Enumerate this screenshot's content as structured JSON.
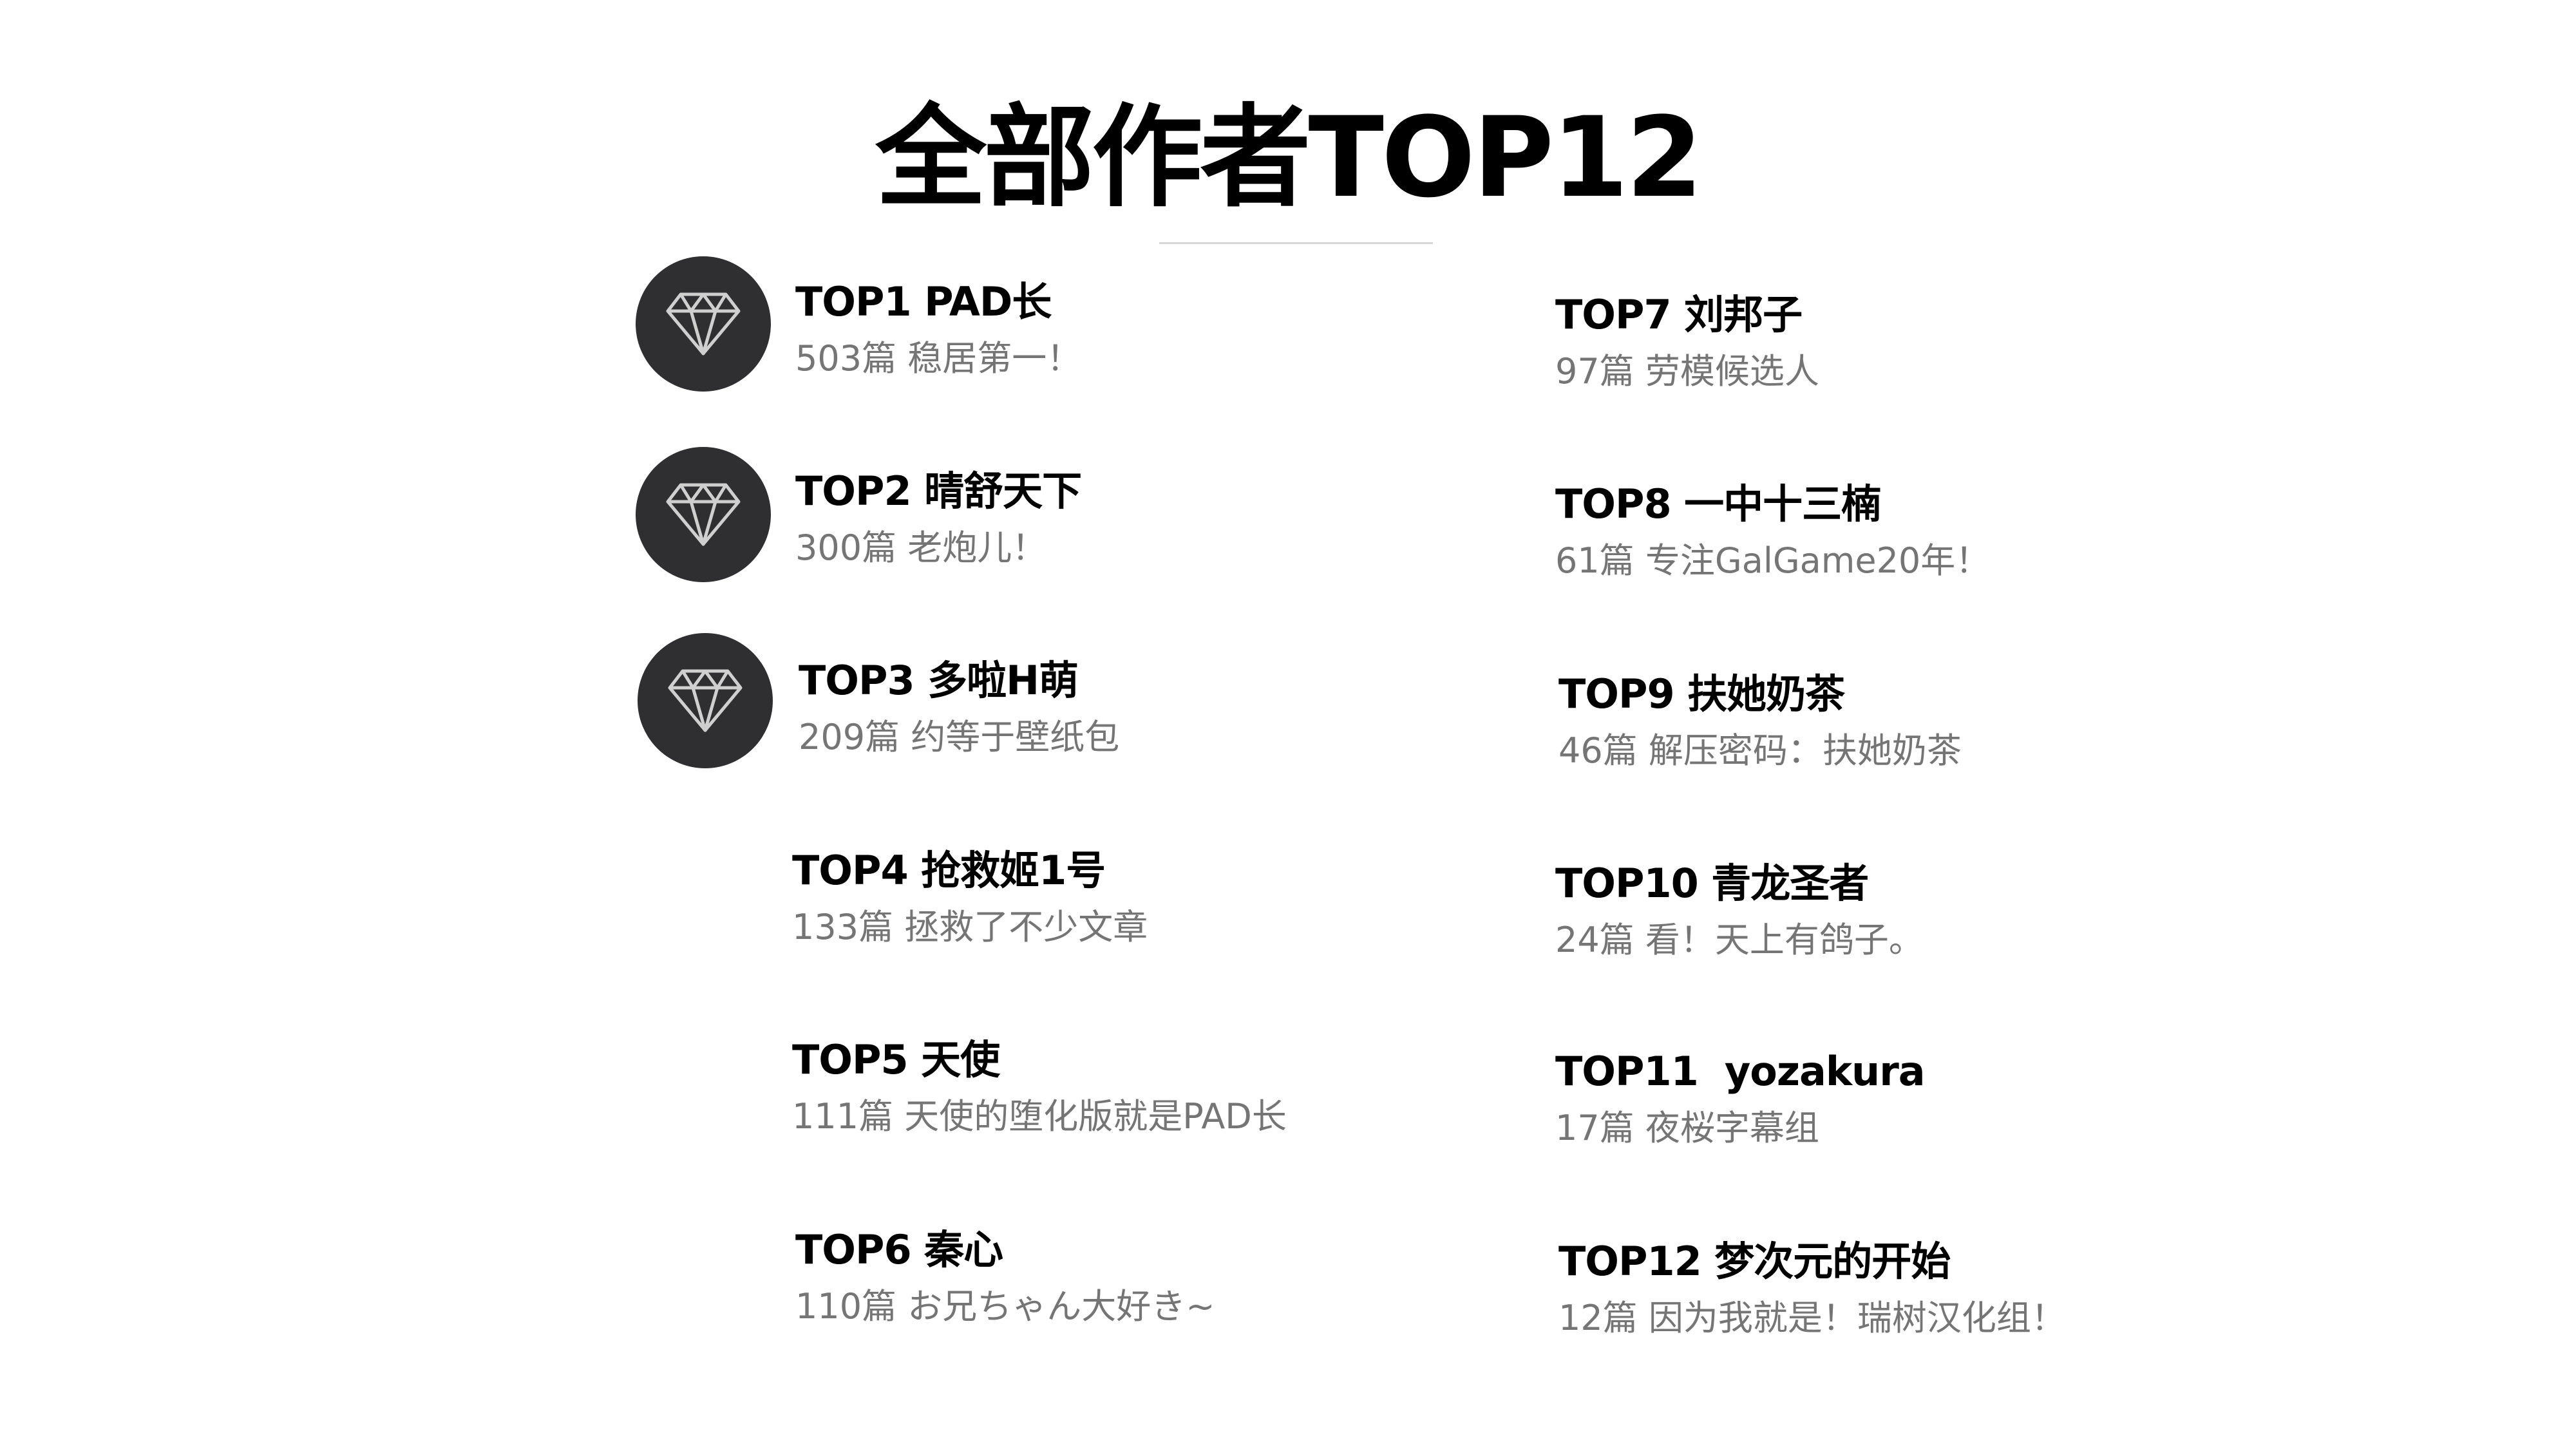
{
  "title": "全部作者TOP12",
  "icons": {
    "badge": "diamond-icon"
  },
  "colors": {
    "badge_bg": "#2f2f31",
    "name": "#000000",
    "desc": "#757575",
    "divider": "#d6d6d6"
  },
  "left_column": [
    {
      "name": "TOP1 PAD长",
      "desc": "503篇 稳居第一！"
    },
    {
      "name": "TOP2 晴舒天下",
      "desc": "300篇 老炮儿！"
    },
    {
      "name": "TOP3 多啦H萌",
      "desc": "209篇 约等于壁纸包"
    },
    {
      "name": "TOP4 抢救姬1号",
      "desc": "133篇 拯救了不少文章"
    },
    {
      "name": "TOP5 天使",
      "desc": "111篇 天使的堕化版就是PAD长"
    },
    {
      "name": "TOP6 秦心",
      "desc": "110篇 お兄ちゃん大好き~"
    }
  ],
  "right_column": [
    {
      "name": "TOP7 刘邦子",
      "desc": "97篇 劳模候选人"
    },
    {
      "name": "TOP8 一中十三楠",
      "desc": "61篇 专注GalGame20年！"
    },
    {
      "name": "TOP9 扶她奶茶",
      "desc": "46篇 解压密码：扶她奶茶"
    },
    {
      "name": "TOP10 青龙圣者",
      "desc": "24篇 看！天上有鸽子。"
    },
    {
      "name": "TOP11  yozakura",
      "desc": "17篇 夜桜字幕组"
    },
    {
      "name": "TOP12 梦次元的开始",
      "desc": "12篇 因为我就是！瑞树汉化组！"
    }
  ]
}
